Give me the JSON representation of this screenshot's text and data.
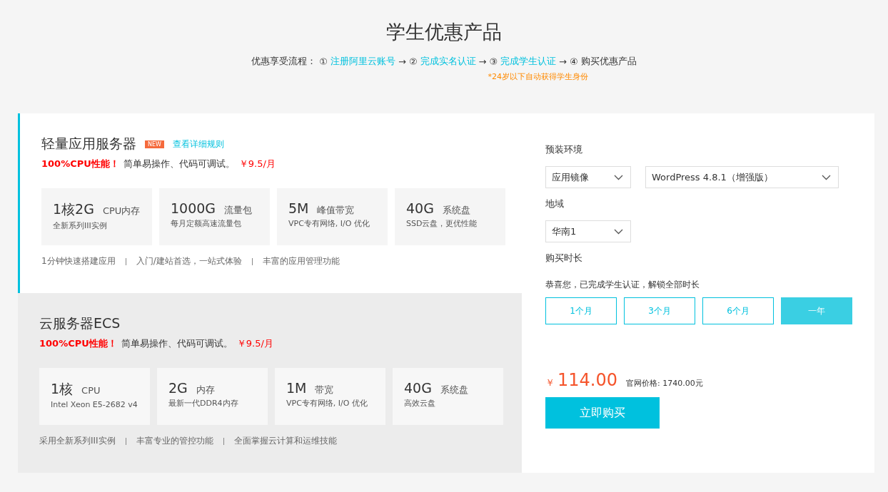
{
  "page_title": "学生优惠产品",
  "flow": {
    "prefix": "优惠享受流程：",
    "separator": "→",
    "steps": [
      {
        "marker": "①",
        "label": "注册阿里云账号",
        "link": true
      },
      {
        "marker": "②",
        "label": "完成实名认证",
        "link": true
      },
      {
        "marker": "③",
        "label": "完成学生认证",
        "link": true
      },
      {
        "marker": "④",
        "label": "购买优惠产品",
        "link": false
      }
    ],
    "note": "*24岁以下自动获得学生身份"
  },
  "products": [
    {
      "name": "轻量应用服务器",
      "selected": true,
      "badge": "NEW",
      "rules_link": "查看详细规则",
      "highlight": "100%CPU性能！",
      "description": "简单易操作、代码可调试。",
      "price": "￥9.5/月",
      "specs": [
        {
          "value": "1核2G",
          "unit": "CPU内存",
          "detail": "全新系列III实例"
        },
        {
          "value": "1000G",
          "unit": "流量包",
          "detail": "每月定额高速流量包"
        },
        {
          "value": "5M",
          "unit": "峰值带宽",
          "detail": "VPC专有网络, I/O 优化"
        },
        {
          "value": "40G",
          "unit": "系统盘",
          "detail": "SSD云盘，更优性能"
        }
      ],
      "features": [
        "1分钟快速搭建应用",
        "入门/建站首选，一站式体验",
        "丰富的应用管理功能"
      ]
    },
    {
      "name": "云服务器ECS",
      "selected": false,
      "highlight": "100%CPU性能！",
      "description": "简单易操作、代码可调试。",
      "price": "￥9.5/月",
      "specs": [
        {
          "value": "1核",
          "unit": "CPU",
          "detail": "Intel Xeon E5-2682 v4"
        },
        {
          "value": "2G",
          "unit": "内存",
          "detail": "最新一代DDR4内存"
        },
        {
          "value": "1M",
          "unit": "带宽",
          "detail": "VPC专有网络, I/O 优化"
        },
        {
          "value": "40G",
          "unit": "系统盘",
          "detail": "高效云盘"
        }
      ],
      "features": [
        "采用全新系列III实例",
        "丰富专业的管控功能",
        "全面掌握云计算和运维技能"
      ]
    }
  ],
  "order": {
    "environment": {
      "label": "预装环境",
      "selects": [
        "应用镜像",
        "WordPress 4.8.1（增强版）"
      ]
    },
    "region": {
      "label": "地域",
      "selects": [
        "华南1"
      ]
    },
    "duration": {
      "label": "购买时长",
      "note": "恭喜您，已完成学生认证，解锁全部时长",
      "options": [
        {
          "label": "1个月",
          "selected": false
        },
        {
          "label": "3个月",
          "selected": false
        },
        {
          "label": "6个月",
          "selected": false
        },
        {
          "label": "一年",
          "selected": true
        }
      ]
    },
    "currency": "￥",
    "price": "114.00",
    "list_price": "官网价格: 1740.00元",
    "buy_button": "立即购买"
  }
}
